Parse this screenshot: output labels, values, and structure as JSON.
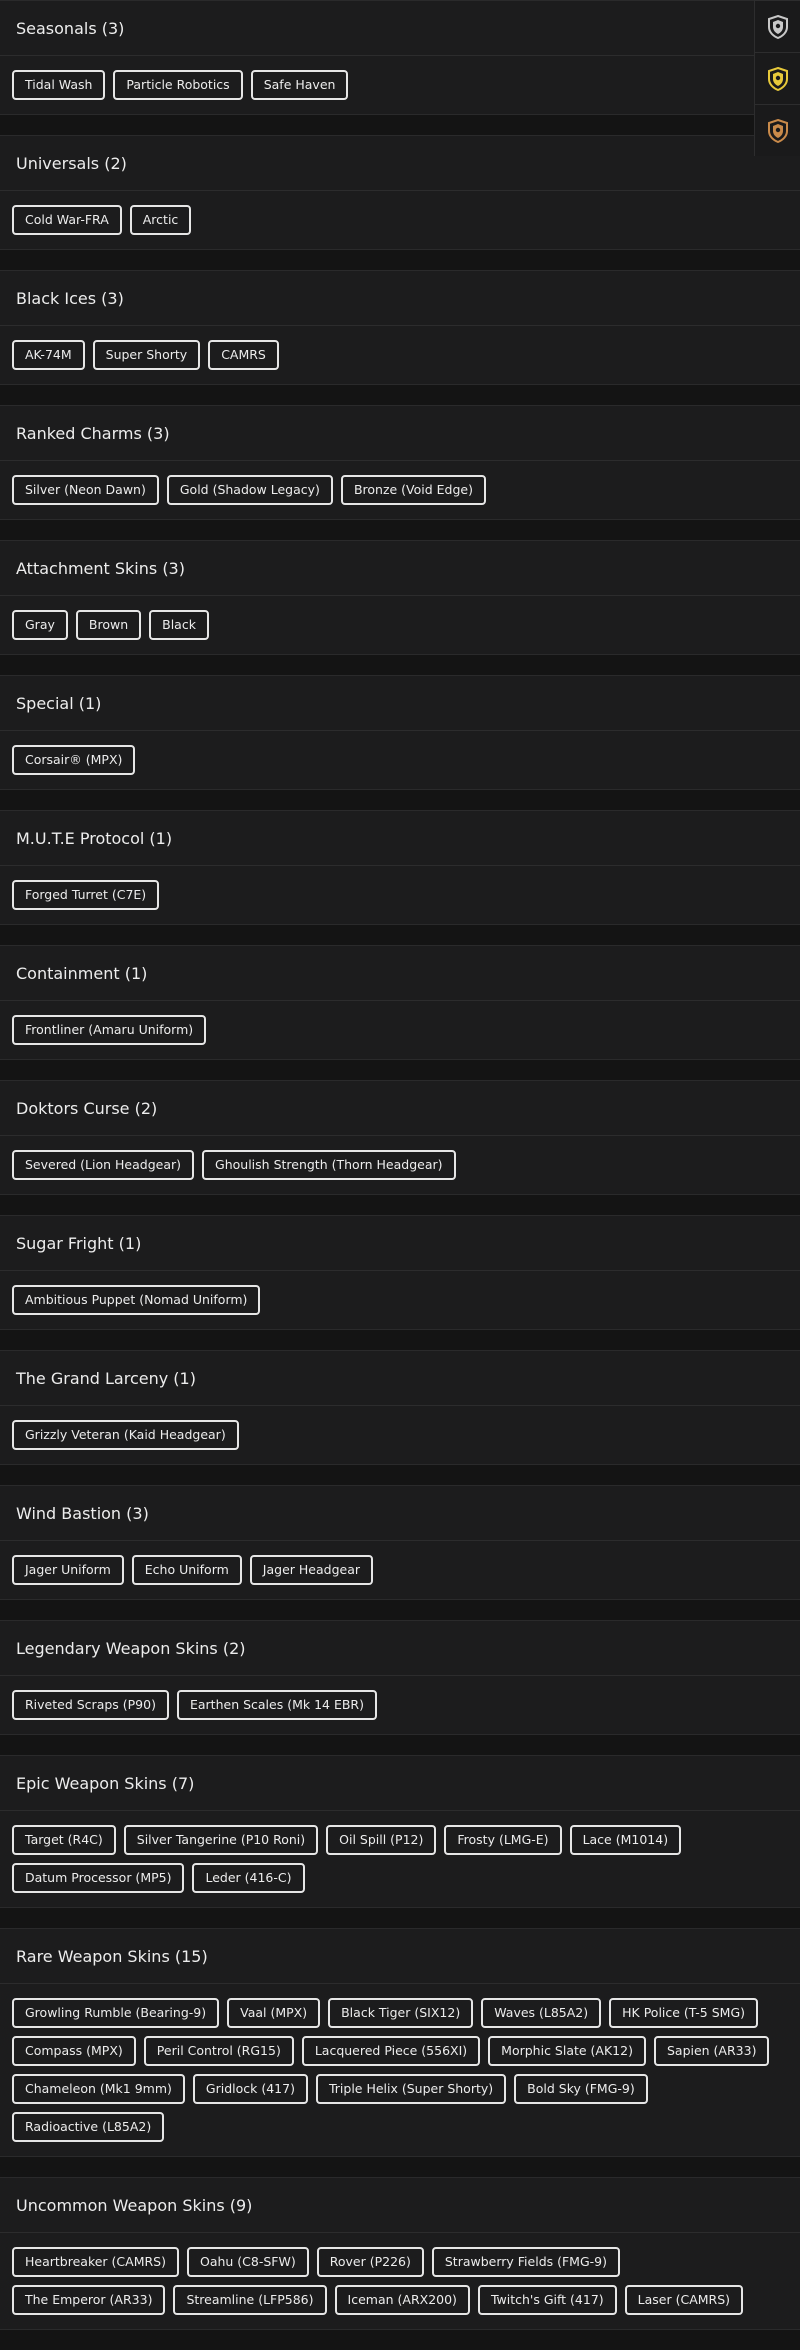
{
  "sections": [
    {
      "title": "Seasonals (3)",
      "items": [
        "Tidal Wash",
        "Particle Robotics",
        "Safe Haven"
      ]
    },
    {
      "title": "Universals (2)",
      "items": [
        "Cold War-FRA",
        "Arctic"
      ]
    },
    {
      "title": "Black Ices (3)",
      "items": [
        "AK-74M",
        "Super Shorty",
        "CAMRS"
      ]
    },
    {
      "title": "Ranked Charms (3)",
      "items": [
        "Silver (Neon Dawn)",
        "Gold (Shadow Legacy)",
        "Bronze (Void Edge)"
      ]
    },
    {
      "title": "Attachment Skins (3)",
      "items": [
        "Gray",
        "Brown",
        "Black"
      ]
    },
    {
      "title": "Special (1)",
      "items": [
        "Corsair® (MPX)"
      ]
    },
    {
      "title": "M.U.T.E Protocol (1)",
      "items": [
        "Forged Turret (C7E)"
      ]
    },
    {
      "title": "Containment (1)",
      "items": [
        "Frontliner (Amaru Uniform)"
      ]
    },
    {
      "title": "Doktors Curse (2)",
      "items": [
        "Severed (Lion Headgear)",
        "Ghoulish Strength (Thorn Headgear)"
      ]
    },
    {
      "title": "Sugar Fright (1)",
      "items": [
        "Ambitious Puppet (Nomad Uniform)"
      ]
    },
    {
      "title": "The Grand Larceny (1)",
      "items": [
        "Grizzly Veteran (Kaid Headgear)"
      ]
    },
    {
      "title": "Wind Bastion (3)",
      "items": [
        "Jager Uniform",
        "Echo Uniform",
        "Jager Headgear"
      ]
    },
    {
      "title": "Legendary Weapon Skins (2)",
      "items": [
        "Riveted Scraps (P90)",
        "Earthen Scales (Mk 14 EBR)"
      ]
    },
    {
      "title": "Epic Weapon Skins (7)",
      "items": [
        "Target (R4C)",
        "Silver Tangerine (P10 Roni)",
        "Oil Spill (P12)",
        "Frosty (LMG-E)",
        "Lace (M1014)",
        "Datum Processor (MP5)",
        "Leder (416-C)"
      ]
    },
    {
      "title": "Rare Weapon Skins (15)",
      "items": [
        "Growling Rumble (Bearing-9)",
        "Vaal (MPX)",
        "Black Tiger (SIX12)",
        "Waves (L85A2)",
        "HK Police (T-5 SMG)",
        "Compass (MPX)",
        "Peril Control (RG15)",
        "Lacquered Piece (556XI)",
        "Morphic Slate (AK12)",
        "Sapien (AR33)",
        "Chameleon (Mk1 9mm)",
        "Gridlock (417)",
        "Triple Helix (Super Shorty)",
        "Bold Sky (FMG-9)",
        "Radioactive (L85A2)"
      ]
    },
    {
      "title": "Uncommon Weapon Skins (9)",
      "items": [
        "Heartbreaker (CAMRS)",
        "Oahu (C8-SFW)",
        "Rover (P226)",
        "Strawberry Fields (FMG-9)",
        "The Emperor (AR33)",
        "Streamline (LFP586)",
        "Iceman (ARX200)",
        "Twitch's Gift (417)",
        "Laser (CAMRS)"
      ]
    }
  ],
  "rank_badges": [
    {
      "icon": "silver-rank-badge-icon",
      "color": "#c8c8c8"
    },
    {
      "icon": "gold-rank-badge-icon",
      "color": "#e7c93a"
    },
    {
      "icon": "bronze-rank-badge-icon",
      "color": "#c98a4a"
    }
  ]
}
